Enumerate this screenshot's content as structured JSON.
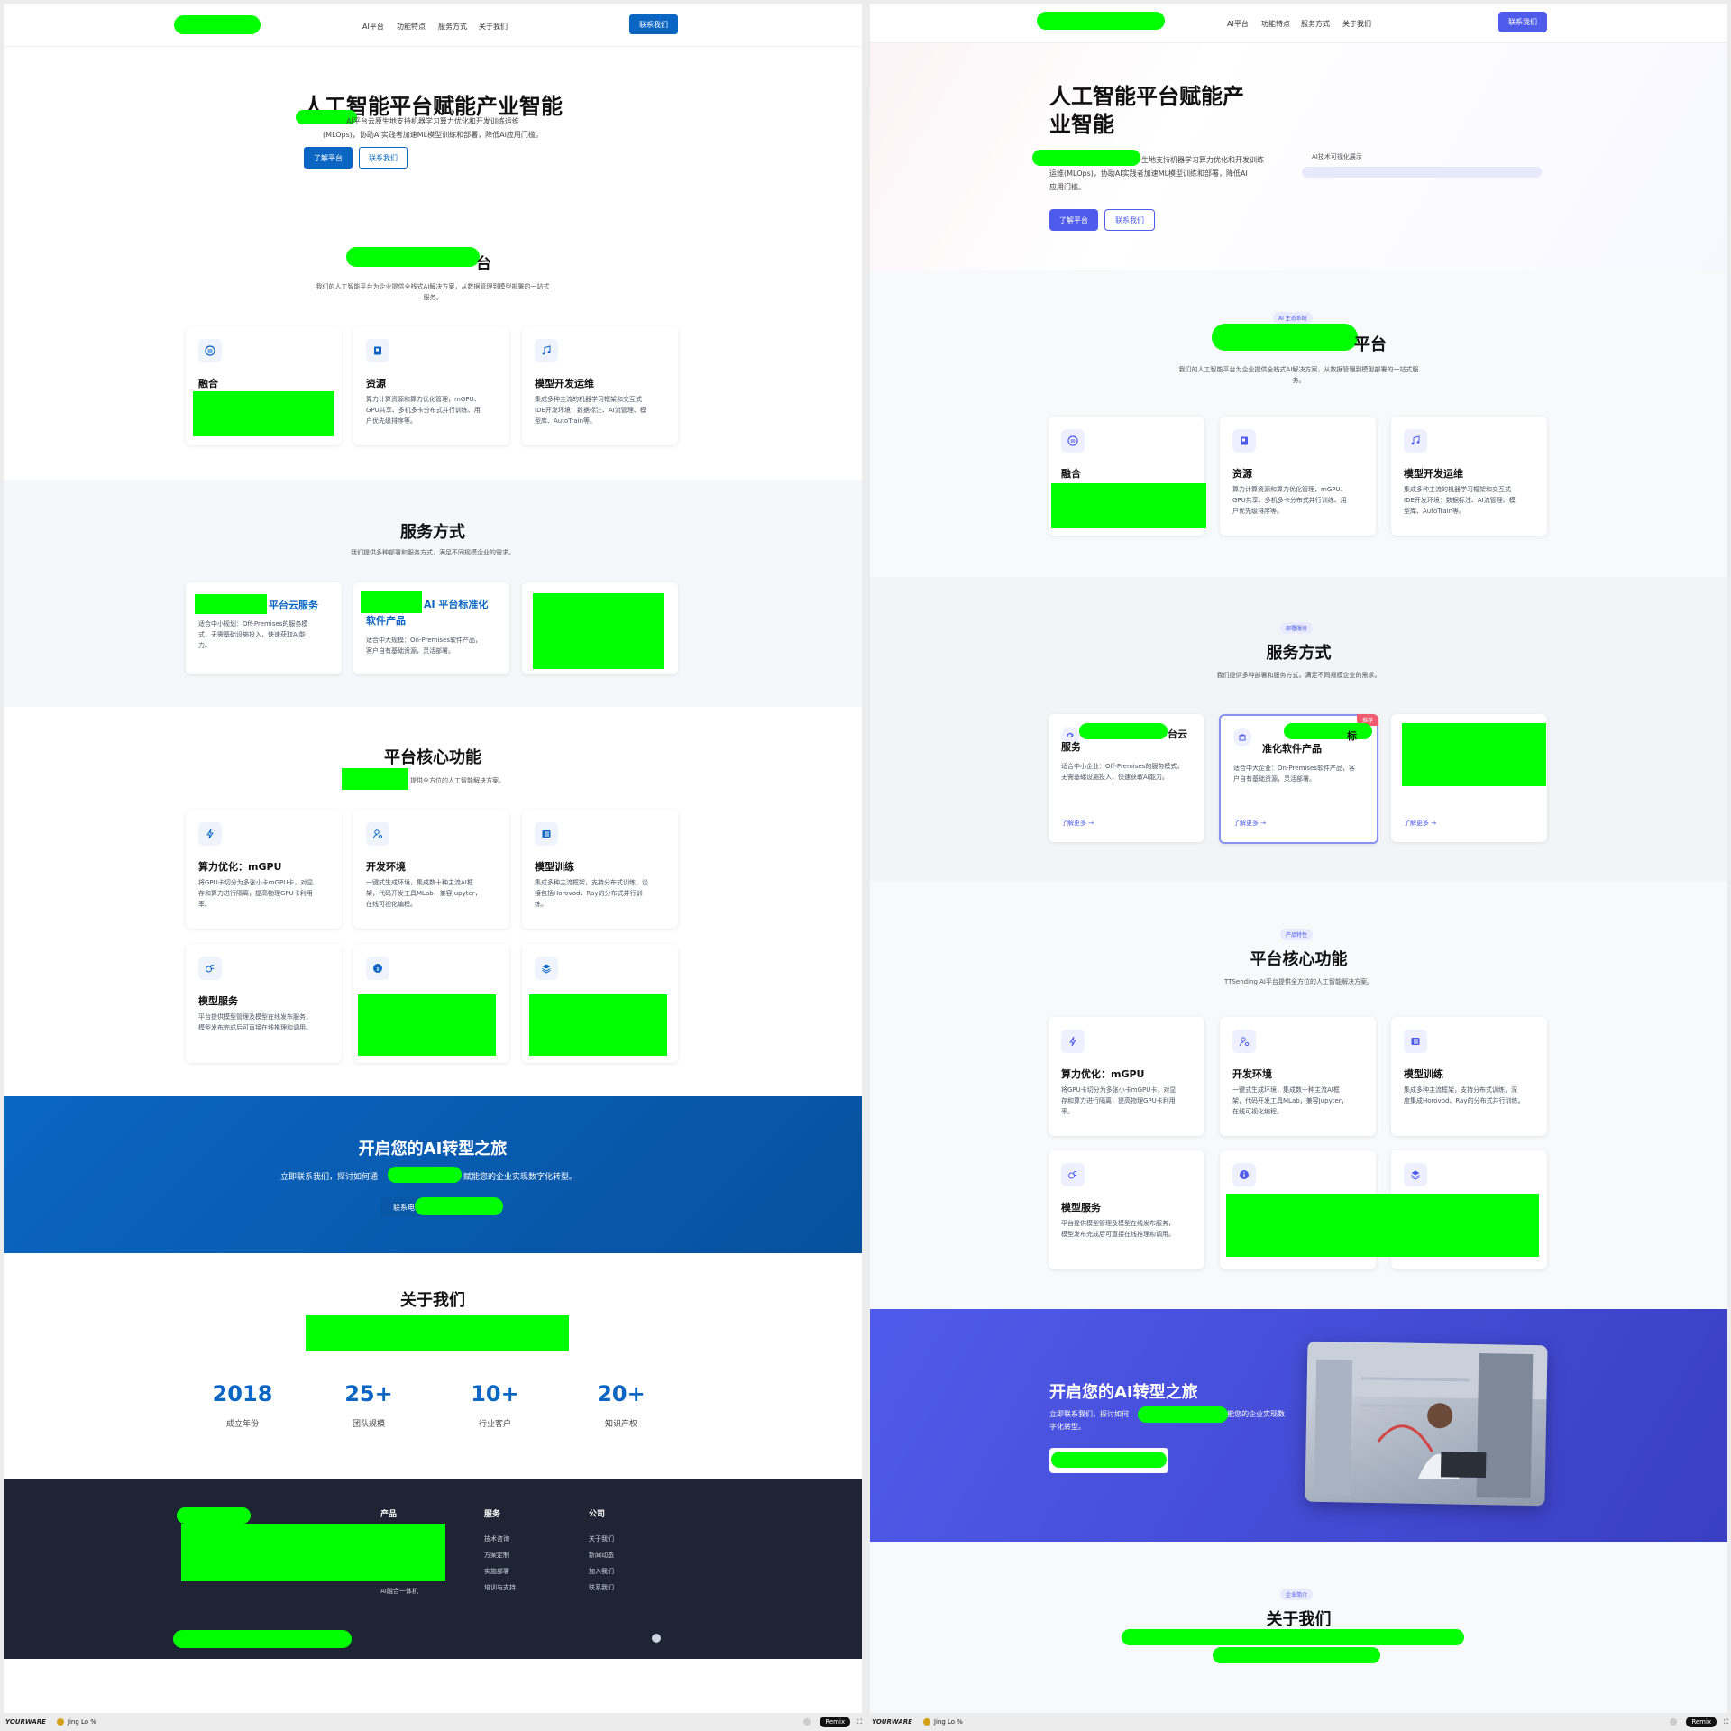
{
  "nav": {
    "links": [
      "AI平台",
      "功能特点",
      "服务方式",
      "关于我们"
    ],
    "contact_button": "联系我们"
  },
  "hero": {
    "title_left": "人工智能平台赋能产业智能",
    "title_right_line1": "人工智能平台赋能产",
    "title_right_line2": "业智能",
    "desc_left_line1": "AI平台云原生地支持机器学习算力优化和开发训练运维",
    "desc_left_line2": "(MLOps)，协助AI实践者加速ML模型训练和部署，降低AI应用门槛。",
    "desc_right_line1": "生地支持机器学习算力优化和开发训练",
    "desc_right_line2": "运维(MLOps)，协助AI实践者加速ML模型训练和部署，降低AI",
    "desc_right_line3": "应用门槛。",
    "btn_primary": "了解平台",
    "btn_secondary": "联系我们",
    "image_alt": "AI技术可视化展示"
  },
  "platform": {
    "badge": "AI 生态系统",
    "title_suffix": "平台",
    "title_suffix_right": "台",
    "desc_left_line1": "我们的人工智能平台为企业提供全栈式AI解决方案，从数据管理到模型部署的一站式",
    "desc_left_line2": "服务。",
    "desc_right_line1": "我们的人工智能平台为企业提供全栈式AI解决方案，从数据管理到模型部署的一站式服",
    "desc_right_line2": "务。",
    "cards": [
      {
        "icon": "menu-circle-icon",
        "title": "融合",
        "desc": [
          "",
          "",
          ""
        ]
      },
      {
        "icon": "book-icon",
        "title": "资源",
        "desc": [
          "算力计算资源和算力优化管理，mGPU、",
          "GPU共享、多机多卡分布式并行训练、用",
          "户优先级排序等。"
        ]
      },
      {
        "icon": "music-note-icon",
        "title": "模型开发运维",
        "desc": [
          "集成多种主流的机器学习框架和交互式",
          "IDE开发环境：数据标注、AI流管理、模",
          "型库、AutoTrain等。"
        ]
      }
    ]
  },
  "service": {
    "badge": "部署服务",
    "title": "服务方式",
    "desc_left": "我们提供多种部署和服务方式，满足不同规模企业的需求。",
    "desc_right": "我们提供多种部署和服务方式，满足不同规模企业的需求。",
    "card1_title_left": "平台云服务",
    "card1_title_right": "台云",
    "card1_title_right2": "服务",
    "card1_desc_left": [
      "适合中小规划：Off-Premises的服务模",
      "式，无需基础设施投入，快速获取AI能",
      "力。"
    ],
    "card1_desc_right": [
      "适合中小企业：Off-Premises的服务模式，",
      "无需基础设施投入，快速获取AI能力。"
    ],
    "card2_title_left1": "AI 平台标准化",
    "card2_title_left2": "软件产品",
    "card2_title_right1": "标",
    "card2_title_right2": "准化软件产品",
    "card2_desc_left": [
      "适合中大规模：On-Premises软件产品，",
      "客户自有基础资源，灵活部署。"
    ],
    "card2_desc_right": [
      "适合中大企业：On-Premises软件产品，客",
      "户自有基础资源，灵活部署。"
    ],
    "card2_tag": "推荐",
    "learn_more": "了解更多 →"
  },
  "features": {
    "badge": "产品特性",
    "title": "平台核心功能",
    "desc_left": "提供全方位的人工智能解决方案。",
    "desc_right": "TTSending AI平台提供全方位的人工智能解决方案。",
    "cards": [
      {
        "icon": "bolt-icon",
        "title": "算力优化：mGPU",
        "desc": [
          "将GPU卡切分为多张小卡mGPU卡，对显",
          "存和算力进行隔离，提高物理GPU卡利用",
          "率。"
        ],
        "desc_right": [
          "将GPU卡切分为多张小卡mGPU卡，对显",
          "存和算力进行隔离，提高物理GPU卡利用",
          "率。"
        ]
      },
      {
        "icon": "user-gear-icon",
        "title": "开发环境",
        "desc": [
          "一键式生成环境，集成数十种主流AI框",
          "架，代码开发工具MLab，兼容Jupyter，",
          "在线可视化编程。"
        ],
        "desc_right": [
          "一键式生成环境，集成数十种主流AI框",
          "架，代码开发工具MLab，兼容Jupyter，",
          "在线可视化编程。"
        ]
      },
      {
        "icon": "list-icon",
        "title": "模型训练",
        "desc": [
          "集成多种主流框架，支持分布式训练，谈",
          "接包括Horovod、Ray的分布式并行训",
          "练。"
        ],
        "desc_right": [
          "集成多种主流框架，支持分布式训练，深",
          "度集成Horovod、Ray的分布式并行训练。"
        ]
      },
      {
        "icon": "model-icon",
        "title": "模型服务",
        "desc": [
          "平台提供模型管理及模型在线发布服务，",
          "模型发布完成后可直接在线推理和调用。"
        ],
        "desc_right": [
          "平台提供模型管理及模型在线发布服务，",
          "模型发布完成后可直接在线推理和调用。"
        ]
      },
      {
        "icon": "info-icon",
        "title": "",
        "desc": [
          "",
          ""
        ],
        "desc_right": [
          "",
          ""
        ]
      },
      {
        "icon": "layers-icon",
        "title": "",
        "desc": [
          "",
          ""
        ],
        "desc_right": [
          "",
          ""
        ]
      }
    ]
  },
  "cta": {
    "title": "开启您的AI转型之旅",
    "desc_left_a": "立即联系我们，探讨如何通",
    "desc_left_b": "赋能您的企业实现数字化转型。",
    "desc_right_a": "立即联系我们，探讨如何",
    "desc_right_b": "赋能您的企业实现数",
    "desc_right_c": "字化转型。",
    "button": "联系电"
  },
  "about": {
    "badge": "企业简介",
    "title": "关于我们",
    "stats": [
      {
        "num": "2018",
        "label": "成立年份"
      },
      {
        "num": "25+",
        "label": "团队规模"
      },
      {
        "num": "10+",
        "label": "行业客户"
      },
      {
        "num": "20+",
        "label": "知识产权"
      }
    ]
  },
  "footer": {
    "col_product": "产品",
    "col_service": "服务",
    "col_company": "公司",
    "product_last": "AI融合一体机",
    "service_links": [
      "技术咨询",
      "方案定制",
      "实施部署",
      "培训与支持"
    ],
    "company_links": [
      "关于我们",
      "新闻动态",
      "加入我们",
      "联系我们"
    ]
  },
  "taskbar": {
    "brand": "YOURWARE",
    "user": "Jing Lo %",
    "remix": "Remix"
  },
  "colors": {
    "primary_blue": "#0a66c2",
    "primary_purple": "#4f5bea",
    "footer_bg": "#1e2433",
    "redaction": "#00ff00"
  }
}
